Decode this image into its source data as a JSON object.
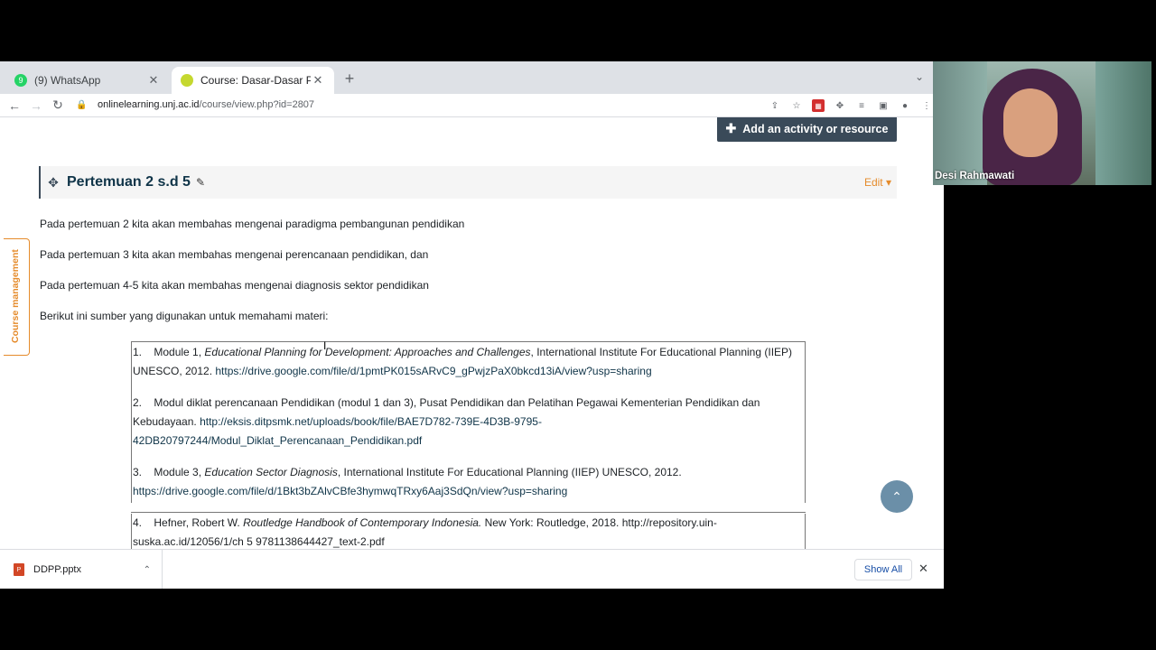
{
  "browser": {
    "tabs": [
      {
        "title": "(9) WhatsApp",
        "favicon": "whatsapp-icon",
        "badge": "9"
      },
      {
        "title": "Course: Dasar-Dasar Perencan",
        "favicon": "moodle-icon"
      }
    ],
    "url_host": "onlinelearning.unj.ac.id",
    "url_path": "/course/view.php?id=2807"
  },
  "page": {
    "add_activity_label": "Add an activity or resource",
    "section_title": "Pertemuan 2 s.d 5",
    "edit_label": "Edit",
    "course_management_label": "Course management",
    "paragraphs": [
      "Pada pertemuan 2 kita akan membahas mengenai paradigma pembangunan pendidikan",
      "Pada pertemuan 3 kita akan membahas mengenai perencanaan pendidikan, dan",
      "Pada pertemuan 4-5 kita akan membahas mengenai diagnosis sektor pendidikan",
      "Berikut ini sumber yang digunakan untuk memahami materi:"
    ],
    "references": [
      {
        "num": "1.",
        "prefix": "Module 1, ",
        "italic": "Educational Planning for Development: Approaches and Challenges",
        "rest": ", International Institute For Educational Planning (IIEP) UNESCO, 2012. ",
        "link": "https://drive.google.com/file/d/1pmtPK015sARvC9_gPwjzPaX0bkcd13iA/view?usp=sharing"
      },
      {
        "num": "2.",
        "prefix": "Modul diklat perencanaan Pendidikan (modul 1 dan 3), Pusat Pendidikan dan Pelatihan Pegawai Kementerian Pendidikan dan Kebudayaan. ",
        "link": "http://eksis.ditpsmk.net/uploads/book/file/BAE7D782-739E-4D3B-9795-42DB20797244/Modul_Diklat_Perencanaan_Pendidikan.pdf"
      },
      {
        "num": "3.",
        "prefix": "Module 3, ",
        "italic": "Education Sector Diagnosis",
        "rest": ", International Institute For Educational Planning (IIEP) UNESCO, 2012.",
        "link": "https://drive.google.com/file/d/1Bkt3bZAlvCBfe3hymwqTRxy6Aaj3SdQn/view?usp=sharing"
      },
      {
        "num": "4.",
        "prefix": "Hefner, Robert W. ",
        "italic": "Routledge Handbook of Contemporary Indonesia.",
        "rest": " New York: Routledge, 2018. ",
        "link": "http://repository.uin-suska.ac.id/12056/1/ch 5 9781138644427_text-2.pdf"
      }
    ]
  },
  "downloads": {
    "file_name": "DDPP.pptx",
    "show_all_label": "Show All"
  },
  "webcam": {
    "participant_name": "Desi Rahmawati"
  },
  "colors": {
    "accent_orange": "#e58b2b",
    "button_dark": "#3a4a59",
    "link_dark": "#0f3448"
  }
}
